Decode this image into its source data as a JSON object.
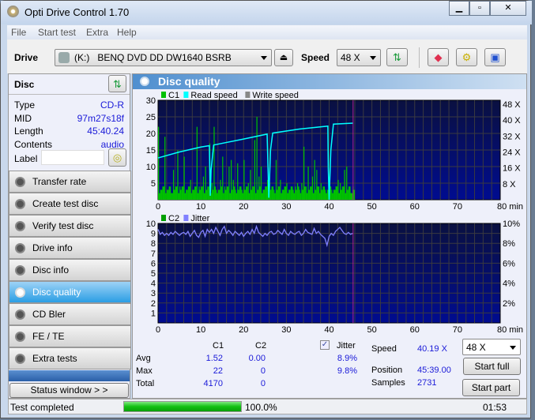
{
  "window": {
    "title": "Opti Drive Control 1.70",
    "controls": [
      "minimize",
      "maximize",
      "close"
    ]
  },
  "menu": [
    "File",
    "Start test",
    "Extra",
    "Help"
  ],
  "toolbar": {
    "drive_label": "Drive",
    "drive_value": "(K:)   BENQ DVD DD DW1640 BSRB",
    "speed_label": "Speed",
    "speed_value": "48 X"
  },
  "disc": {
    "header": "Disc",
    "rows": [
      {
        "k": "Type",
        "v": "CD-R"
      },
      {
        "k": "MID",
        "v": "97m27s18f"
      },
      {
        "k": "Length",
        "v": "45:40.24"
      },
      {
        "k": "Contents",
        "v": "audio"
      }
    ],
    "label_label": "Label",
    "label_value": ""
  },
  "nav": [
    {
      "label": "Transfer rate"
    },
    {
      "label": "Create test disc"
    },
    {
      "label": "Verify test disc"
    },
    {
      "label": "Drive info"
    },
    {
      "label": "Disc info"
    },
    {
      "label": "Disc quality",
      "selected": true
    },
    {
      "label": "CD Bler"
    },
    {
      "label": "FE / TE"
    },
    {
      "label": "Extra tests"
    }
  ],
  "status_window_button": "Status window > >",
  "panel_title": "Disc quality",
  "chart_data": [
    {
      "type": "bar+line",
      "legend": [
        "C1",
        "Read speed",
        "Write speed"
      ],
      "colors": {
        "C1": "#00c000",
        "Read speed": "#00ffff",
        "Write speed": "#888888"
      },
      "xlim": [
        0,
        80
      ],
      "xticks": [
        "0",
        "10",
        "20",
        "30",
        "40",
        "50",
        "60",
        "70",
        "80 min"
      ],
      "ylim": [
        0,
        30
      ],
      "yticks": [
        "5",
        "10",
        "15",
        "20",
        "25",
        "30"
      ],
      "y2ticks": [
        "8 X",
        "16 X",
        "24 X",
        "32 X",
        "40 X",
        "48 X"
      ],
      "y2lim": [
        0,
        50
      ],
      "end_marker": 45.6,
      "c1_step": 0.5,
      "c1": [
        22,
        3,
        2,
        19,
        3,
        2,
        2,
        9,
        3,
        15,
        4,
        2,
        13,
        3,
        3,
        6,
        3,
        2,
        22,
        4,
        3,
        7,
        10,
        3,
        17,
        5,
        22,
        3,
        2,
        6,
        13,
        4,
        3,
        10,
        12,
        6,
        3,
        11,
        4,
        3,
        12,
        3,
        5,
        9,
        4,
        18,
        25,
        7,
        10,
        3,
        4,
        6,
        5,
        3,
        3,
        12,
        4,
        6,
        3,
        4,
        5,
        3,
        2,
        3,
        4,
        5,
        3,
        5,
        16,
        4,
        10,
        3,
        7,
        12,
        9,
        4,
        5,
        3,
        3,
        2,
        7,
        3,
        3,
        4,
        6,
        5,
        3,
        9,
        10,
        3,
        2,
        4
      ],
      "read_speed": [
        [
          0,
          21
        ],
        [
          5,
          24
        ],
        [
          10,
          26.5
        ],
        [
          12,
          27.2
        ],
        [
          12.1,
          15
        ],
        [
          12.2,
          2
        ],
        [
          12.4,
          15
        ],
        [
          13,
          27.5
        ],
        [
          20,
          30.5
        ],
        [
          25.5,
          33
        ],
        [
          25.7,
          17
        ],
        [
          25.9,
          1
        ],
        [
          26.3,
          25
        ],
        [
          26.8,
          33.5
        ],
        [
          33,
          35.5
        ],
        [
          39.7,
          37
        ],
        [
          39.8,
          16
        ],
        [
          40,
          0
        ],
        [
          40.4,
          25
        ],
        [
          41,
          38
        ],
        [
          45.6,
          38.5
        ]
      ]
    },
    {
      "type": "bar+line",
      "legend": [
        "C2",
        "Jitter"
      ],
      "colors": {
        "C2": "#00a000",
        "Jitter": "#8080ff"
      },
      "xlim": [
        0,
        80
      ],
      "xticks": [
        "0",
        "10",
        "20",
        "30",
        "40",
        "50",
        "60",
        "70",
        "80 min"
      ],
      "ylim": [
        0,
        10
      ],
      "yticks": [
        "1",
        "2",
        "3",
        "4",
        "5",
        "6",
        "7",
        "8",
        "9",
        "10"
      ],
      "y2ticks": [
        "2%",
        "4%",
        "6%",
        "8%",
        "10%"
      ],
      "y2lim": [
        0,
        10
      ],
      "end_marker": 45.6,
      "jitter_step": 0.5,
      "jitter": [
        9.4,
        8.9,
        9.1,
        8.8,
        9.0,
        8.8,
        9.1,
        8.9,
        9.2,
        9.0,
        8.8,
        9.0,
        9.1,
        8.9,
        9.2,
        8.7,
        9.0,
        9.3,
        8.8,
        8.6,
        9.1,
        9.3,
        8.7,
        9.4,
        9.1,
        9.4,
        9.0,
        9.6,
        9.2,
        8.8,
        9.4,
        9.7,
        9.0,
        9.3,
        9.1,
        8.8,
        9.2,
        9.0,
        8.8,
        9.1,
        8.7,
        9.0,
        9.2,
        8.9,
        9.4,
        9.0,
        9.7,
        9.1,
        8.9,
        8.7,
        9.0,
        8.8,
        9.1,
        9.2,
        8.9,
        9.0,
        9.3,
        9.1,
        8.9,
        9.4,
        9.0,
        8.8,
        9.2,
        9.0,
        8.9,
        9.1,
        9.2,
        8.8,
        9.0,
        9.4,
        9.1,
        9.0,
        8.9,
        9.5,
        9.0,
        9.2,
        8.9,
        8.7,
        8.5,
        7.8,
        8.7,
        9.0,
        8.8,
        9.2,
        9.4,
        9.6,
        9.3,
        9.0,
        8.9,
        9.1,
        8.9,
        9.0
      ]
    }
  ],
  "stats": {
    "col_c1": "C1",
    "col_c2": "C2",
    "rows": [
      {
        "k": "Avg",
        "c1": "1.52",
        "c2": "0.00",
        "jit": "8.9%"
      },
      {
        "k": "Max",
        "c1": "22",
        "c2": "0",
        "jit": "9.8%"
      },
      {
        "k": "Total",
        "c1": "4170",
        "c2": "0",
        "jit": ""
      }
    ],
    "jitter_label": "Jitter",
    "jitter_checked": true
  },
  "info": {
    "speed_label": "Speed",
    "speed": "40.19 X",
    "position_label": "Position",
    "position": "45:39.00",
    "samples_label": "Samples",
    "samples": "2731"
  },
  "controls": {
    "speed_value": "48 X",
    "start_full": "Start full",
    "start_part": "Start part"
  },
  "statusbar": {
    "text": "Test completed",
    "progress_pct": 100,
    "progress_text": "100.0%",
    "time": "01:53"
  }
}
